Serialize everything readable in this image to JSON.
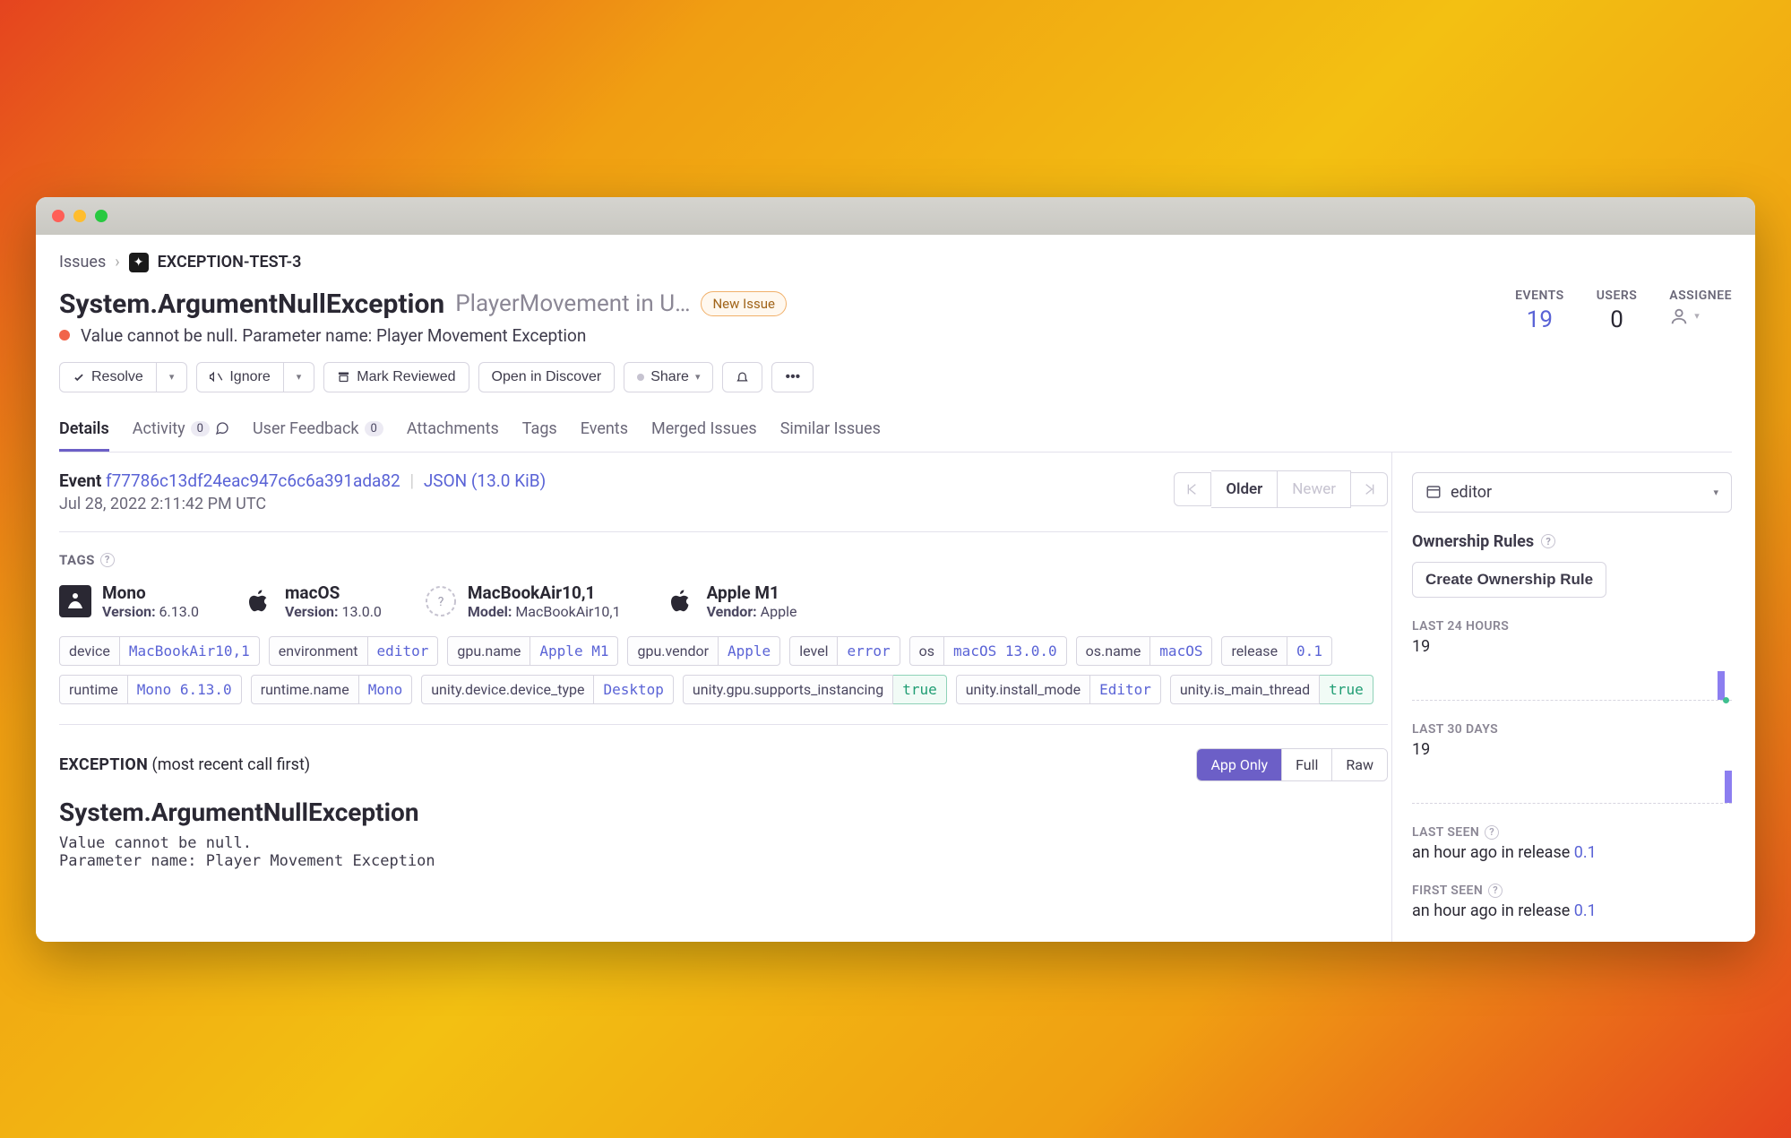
{
  "breadcrumb": {
    "root": "Issues",
    "current": "EXCEPTION-TEST-3"
  },
  "issue": {
    "title": "System.ArgumentNullException",
    "context": "PlayerMovement in U…",
    "badge": "New Issue",
    "message": "Value cannot be null. Parameter name: Player Movement Exception"
  },
  "metrics": {
    "events_label": "EVENTS",
    "events_value": "19",
    "users_label": "USERS",
    "users_value": "0",
    "assignee_label": "ASSIGNEE"
  },
  "actions": {
    "resolve": "Resolve",
    "ignore": "Ignore",
    "mark_reviewed": "Mark Reviewed",
    "open_discover": "Open in Discover",
    "share": "Share"
  },
  "tabs": {
    "details": "Details",
    "activity": "Activity",
    "activity_count": "0",
    "feedback": "User Feedback",
    "feedback_count": "0",
    "attachments": "Attachments",
    "tags": "Tags",
    "events": "Events",
    "merged": "Merged Issues",
    "similar": "Similar Issues"
  },
  "event": {
    "label": "Event",
    "id": "f77786c13df24eac947c6c6a391ada82",
    "json": "JSON (13.0 KiB)",
    "date": "Jul 28, 2022 2:11:42 PM UTC",
    "older": "Older",
    "newer": "Newer"
  },
  "tags_header": "TAGS",
  "context": {
    "mono": {
      "title": "Mono",
      "sub_label": "Version:",
      "sub_value": "6.13.0"
    },
    "macos": {
      "title": "macOS",
      "sub_label": "Version:",
      "sub_value": "13.0.0"
    },
    "device": {
      "title": "MacBookAir10,1",
      "sub_label": "Model:",
      "sub_value": "MacBookAir10,1"
    },
    "chip": {
      "title": "Apple M1",
      "sub_label": "Vendor:",
      "sub_value": "Apple"
    }
  },
  "tags": [
    {
      "k": "device",
      "v": "MacBookAir10,1",
      "style": "blue"
    },
    {
      "k": "environment",
      "v": "editor",
      "style": "blue"
    },
    {
      "k": "gpu.name",
      "v": "Apple M1",
      "style": "blue"
    },
    {
      "k": "gpu.vendor",
      "v": "Apple",
      "style": "blue"
    },
    {
      "k": "level",
      "v": "error",
      "style": "blue"
    },
    {
      "k": "os",
      "v": "macOS 13.0.0",
      "style": "blue"
    },
    {
      "k": "os.name",
      "v": "macOS",
      "style": "blue"
    },
    {
      "k": "release",
      "v": "0.1",
      "style": "blue"
    },
    {
      "k": "runtime",
      "v": "Mono 6.13.0",
      "style": "blue"
    },
    {
      "k": "runtime.name",
      "v": "Mono",
      "style": "blue"
    },
    {
      "k": "unity.device.device_type",
      "v": "Desktop",
      "style": "blue"
    },
    {
      "k": "unity.gpu.supports_instancing",
      "v": "true",
      "style": "green"
    },
    {
      "k": "unity.install_mode",
      "v": "Editor",
      "style": "blue"
    },
    {
      "k": "unity.is_main_thread",
      "v": "true",
      "style": "green"
    }
  ],
  "exception": {
    "head": "EXCEPTION",
    "hint": "(most recent call first)",
    "view": {
      "app_only": "App Only",
      "full": "Full",
      "raw": "Raw"
    },
    "name": "System.ArgumentNullException",
    "message": "Value cannot be null.\nParameter name: Player Movement Exception"
  },
  "sidebar": {
    "env_value": "editor",
    "ownership_title": "Ownership Rules",
    "create_rule": "Create Ownership Rule",
    "last24_label": "LAST 24 HOURS",
    "last24_value": "19",
    "last30_label": "LAST 30 DAYS",
    "last30_value": "19",
    "last_seen_label": "LAST SEEN",
    "last_seen_text": "an hour ago",
    "in_release": "in release",
    "last_seen_release": "0.1",
    "first_seen_label": "FIRST SEEN",
    "first_seen_text": "an hour ago",
    "first_seen_release": "0.1"
  }
}
